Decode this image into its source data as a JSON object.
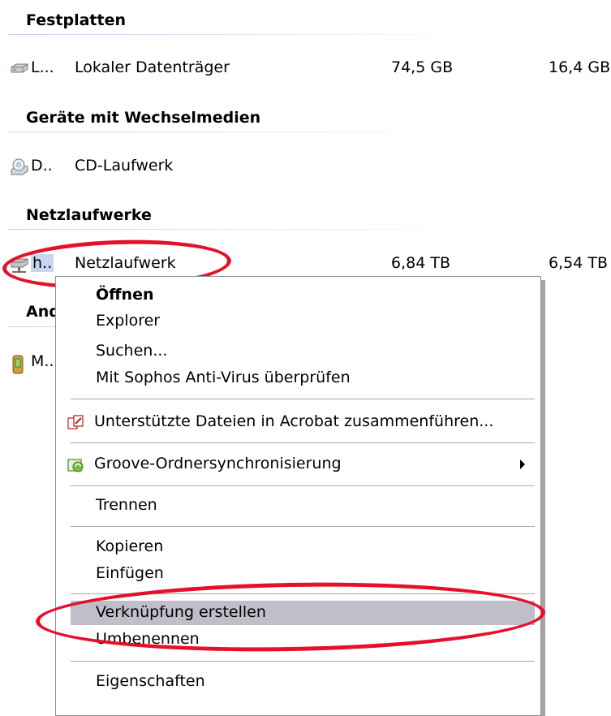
{
  "groups": {
    "hard_disks": "Festplatten",
    "removable": "Geräte mit Wechselmedien",
    "network": "Netzlaufwerke",
    "other": "And"
  },
  "drives": {
    "local": {
      "short": "L...",
      "type": "Lokaler Datenträger",
      "total": "74,5 GB",
      "free": "16,4 GB",
      "icon": "hard-drive-icon"
    },
    "cd": {
      "short": "D..",
      "type": "CD-Laufwerk",
      "icon": "cd-drive-icon"
    },
    "network": {
      "short": "h..",
      "type": "Netzlaufwerk",
      "total": "6,84 TB",
      "free": "6,54 TB",
      "icon": "network-drive-icon"
    },
    "other": {
      "short": "M..",
      "icon": "device-icon"
    }
  },
  "context_menu": {
    "open": "Öffnen",
    "explorer": "Explorer",
    "search": "Suchen...",
    "sophos": "Mit Sophos Anti-Virus überprüfen",
    "acrobat": "Unterstützte Dateien in Acrobat zusammenführen...",
    "groove": "Groove-Ordnersynchronisierung",
    "disconnect": "Trennen",
    "copy": "Kopieren",
    "paste": "Einfügen",
    "create_shortcut": "Verknüpfung erstellen",
    "rename": "Umbenennen",
    "properties": "Eigenschaften",
    "hover_color": "#c0bfc9",
    "annotation_color": "#e5112b"
  }
}
